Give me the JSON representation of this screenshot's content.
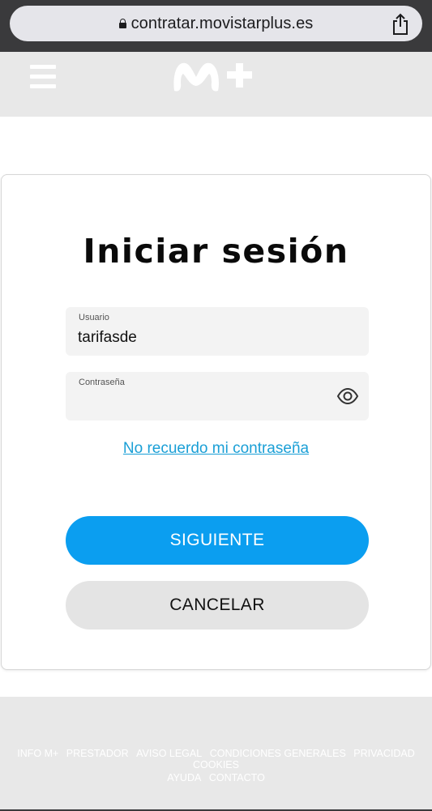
{
  "browser": {
    "url": "contratar.movistarplus.es"
  },
  "header": {
    "logo_alt": "M+"
  },
  "login": {
    "title": "Iniciar sesión",
    "username_label": "Usuario",
    "username_value": "tarifasde",
    "password_label": "Contraseña",
    "password_value": "",
    "forgot_link": "No recuerdo mi contraseña",
    "next_button": "SIGUIENTE",
    "cancel_button": "CANCELAR"
  },
  "footer": {
    "links_row1": [
      "INFO M+",
      "PRESTADOR",
      "AVISO LEGAL",
      "CONDICIONES GENERALES",
      "PRIVACIDAD",
      "COOKIES"
    ],
    "links_row2": [
      "AYUDA",
      "CONTACTO"
    ]
  },
  "colors": {
    "accent": "#0b9ef0",
    "link": "#1a9fd6",
    "header_bg": "#e8e8e8",
    "browser_bar": "#3a3a3c"
  },
  "icons": {
    "lock": "lock-icon",
    "share": "share-icon",
    "menu": "hamburger-menu-icon",
    "eye": "eye-icon"
  }
}
